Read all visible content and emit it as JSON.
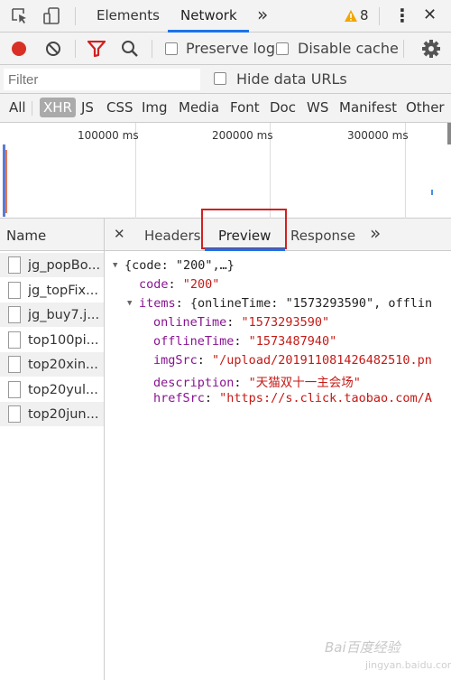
{
  "topbar": {
    "tabs": [
      "Elements",
      "Network"
    ],
    "more": "»",
    "warning_count": "8",
    "menu": "⋮",
    "close": "✕"
  },
  "toolbar": {
    "preserve_log": "Preserve log",
    "disable_cache": "Disable cache"
  },
  "filter": {
    "placeholder": "Filter",
    "hide_data_urls": "Hide data URLs"
  },
  "types": [
    "All",
    "XHR",
    "JS",
    "CSS",
    "Img",
    "Media",
    "Font",
    "Doc",
    "WS",
    "Manifest",
    "Other"
  ],
  "timeline": {
    "ticks": [
      "100000 ms",
      "200000 ms",
      "300000 ms"
    ]
  },
  "requests": {
    "header": "Name",
    "items": [
      "jg_popBo...",
      "jg_topFix...",
      "jg_buy7.j...",
      "top100pi...",
      "top20xin...",
      "top20yul...",
      "top20jun..."
    ]
  },
  "detail": {
    "close": "✕",
    "tabs": [
      "Headers",
      "Preview",
      "Response"
    ],
    "more": "»"
  },
  "preview": {
    "root": "{code: \"200\",…}",
    "code_key": "code",
    "code_val": "\"200\"",
    "items_key": "items",
    "items_summary": "{onlineTime: \"1573293590\", offlin",
    "online_key": "onlineTime",
    "online_val": "\"1573293590\"",
    "offline_key": "offlineTime",
    "offline_val": "\"1573487940\"",
    "img_key": "imgSrc",
    "img_val": "\"/upload/201911081426482510.pn",
    "desc_key": "description",
    "desc_val": "\"天猫双十一主会场\"",
    "href_key": "hrefSrc",
    "href_val": "\"https://s.click.taobao.com/A"
  },
  "watermark": {
    "main": "Bai百度经验",
    "sub": "jingyan.baidu.com"
  },
  "colors": {
    "record": "#d93025",
    "filter_icon": "#d32020",
    "warning": "#f2a600",
    "accent": "#1a73e8",
    "highlight_box": "#d32020"
  }
}
